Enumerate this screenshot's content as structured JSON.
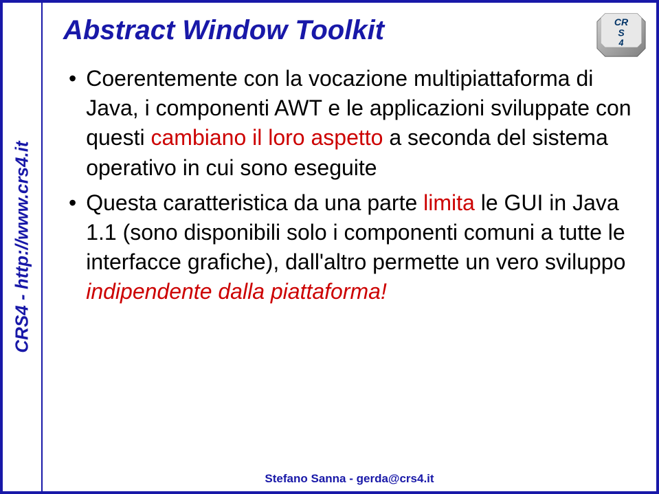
{
  "sidebar": {
    "text": "CRS4 - http://www.crs4.it"
  },
  "title": "Abstract Window Toolkit",
  "logo": {
    "name": "crs4-logo"
  },
  "bullets": [
    {
      "part1": "Coerentemente con la vocazione multipiattaforma di Java, i componenti AWT e le applicazioni sviluppate con questi ",
      "red1": "cambiano il loro aspetto",
      "part2": " a seconda del sistema operativo in cui sono eseguite"
    },
    {
      "part1": "Questa caratteristica da una parte ",
      "red1": "limita",
      "part2": " le GUI in Java 1.1 (sono disponibili solo i componenti comuni a tutte le interfacce grafiche), dall'altro permette un vero sviluppo ",
      "red2": "indipendente dalla piattaforma!"
    }
  ],
  "footer": "Stefano Sanna - gerda@crs4.it"
}
